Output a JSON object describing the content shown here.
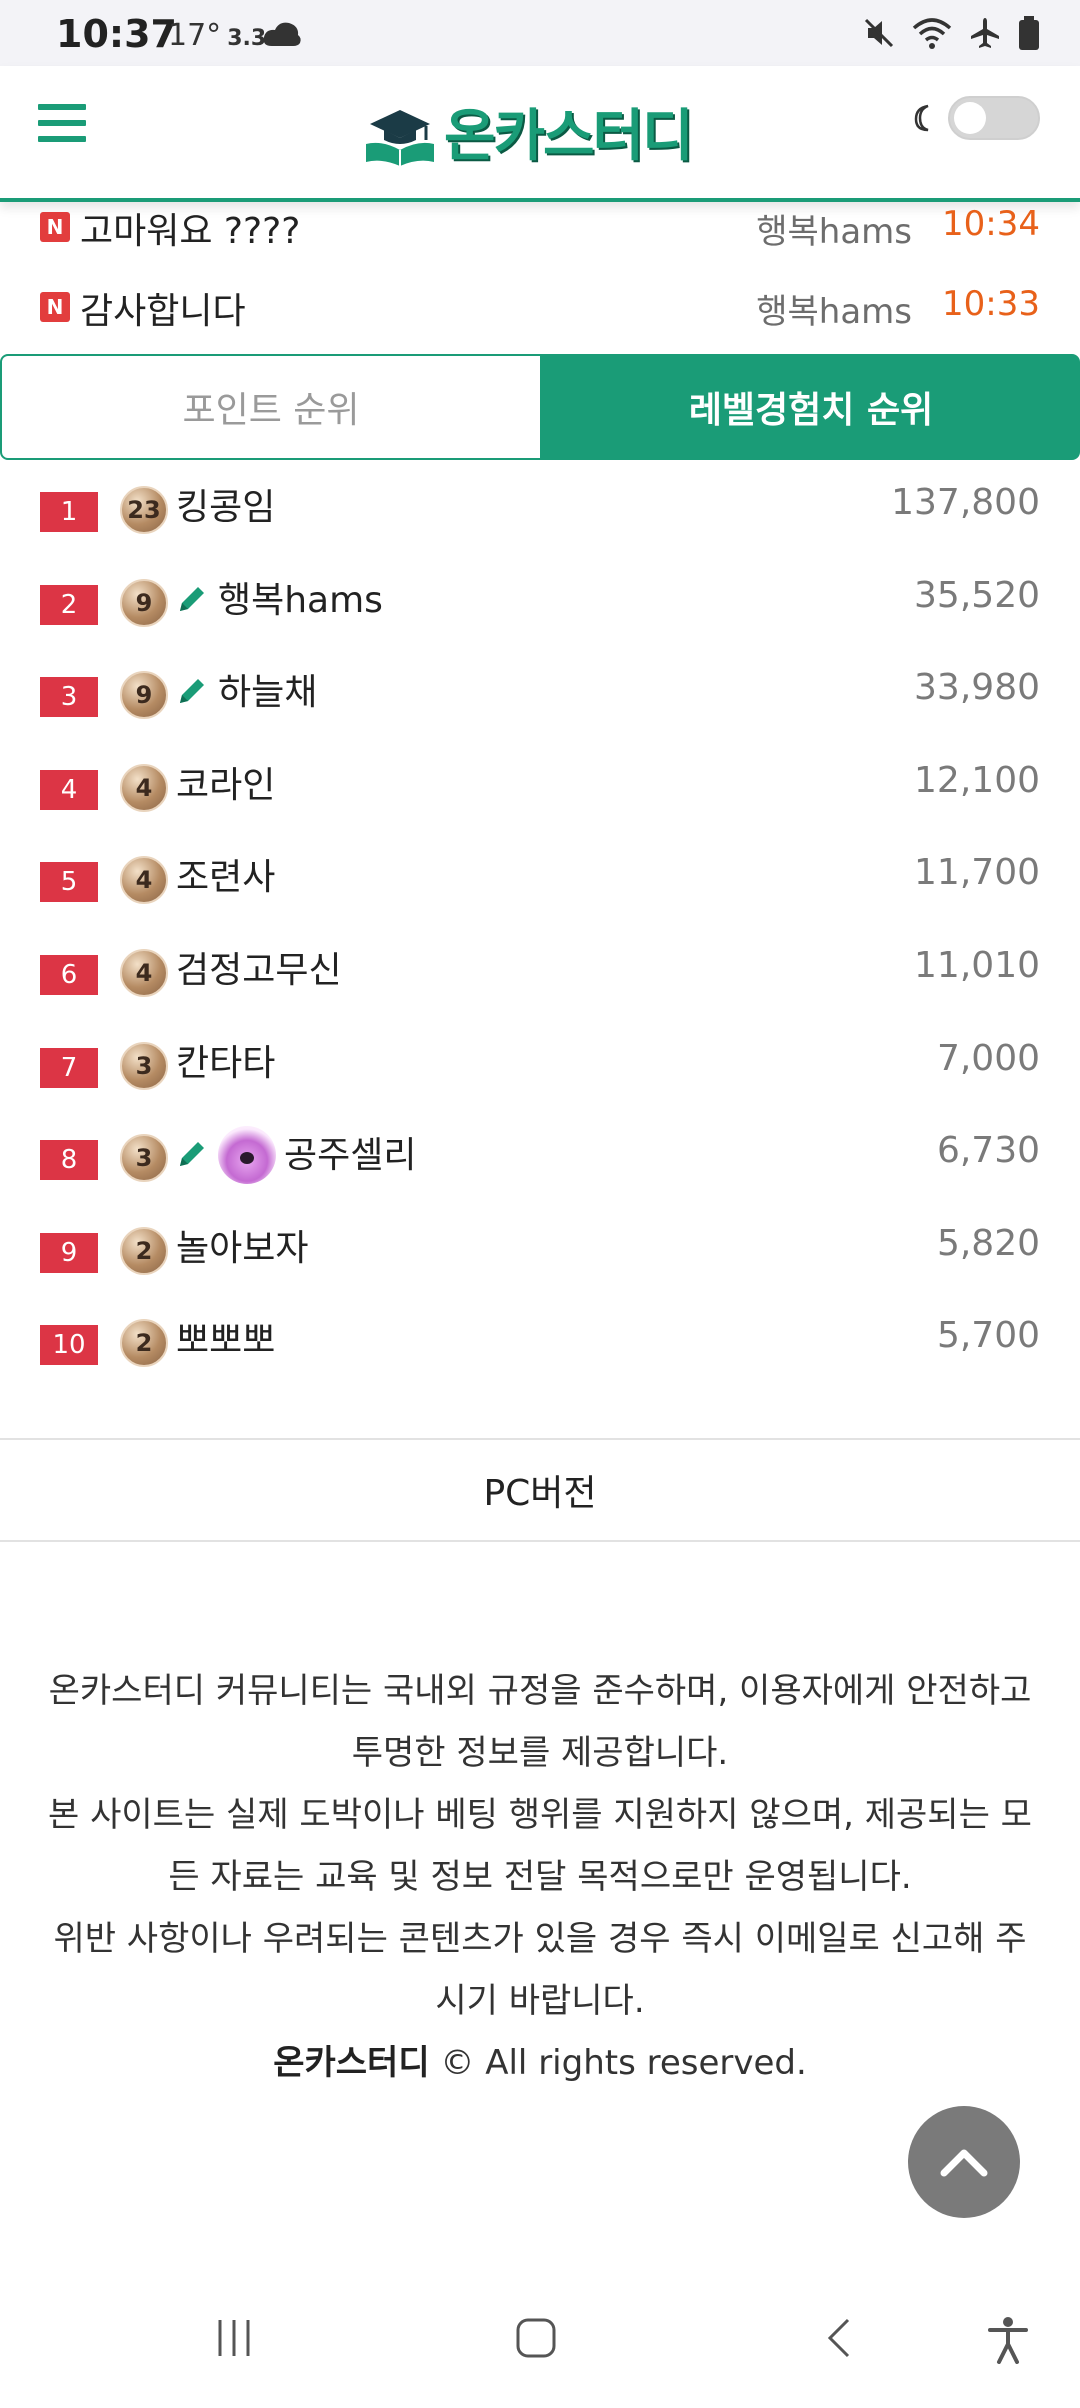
{
  "status_bar": {
    "time": "10:37",
    "temperature": "17°",
    "speed": "3.3",
    "icons": [
      "mute-icon",
      "wifi-icon",
      "airplane-icon",
      "battery-icon"
    ]
  },
  "header": {
    "logo_text": "온카스터디",
    "menu_icon": "hamburger-icon",
    "dark_mode_icon": "moon-icon"
  },
  "recent_comments": [
    {
      "badge": "N",
      "title": "고마워요 ????",
      "author": "행복hams",
      "time": "10:34"
    },
    {
      "badge": "N",
      "title": "감사합니다",
      "author": "행복hams",
      "time": "10:33"
    }
  ],
  "tabs": [
    {
      "label": "포인트 순위",
      "active": false
    },
    {
      "label": "레벨경험치 순위",
      "active": true
    }
  ],
  "ranking": [
    {
      "rank": "1",
      "level": "23",
      "name": "킹콩임",
      "score": "137,800",
      "pencil": false,
      "avatar": false
    },
    {
      "rank": "2",
      "level": "9",
      "name": "행복hams",
      "score": "35,520",
      "pencil": true,
      "avatar": false
    },
    {
      "rank": "3",
      "level": "9",
      "name": "하늘채",
      "score": "33,980",
      "pencil": true,
      "avatar": false
    },
    {
      "rank": "4",
      "level": "4",
      "name": "코라인",
      "score": "12,100",
      "pencil": false,
      "avatar": false
    },
    {
      "rank": "5",
      "level": "4",
      "name": "조련사",
      "score": "11,700",
      "pencil": false,
      "avatar": false
    },
    {
      "rank": "6",
      "level": "4",
      "name": "검정고무신",
      "score": "11,010",
      "pencil": false,
      "avatar": false
    },
    {
      "rank": "7",
      "level": "3",
      "name": "칸타타",
      "score": "7,000",
      "pencil": false,
      "avatar": false
    },
    {
      "rank": "8",
      "level": "3",
      "name": "공주셀리",
      "score": "6,730",
      "pencil": true,
      "avatar": true
    },
    {
      "rank": "9",
      "level": "2",
      "name": "놀아보자",
      "score": "5,820",
      "pencil": false,
      "avatar": false
    },
    {
      "rank": "10",
      "level": "2",
      "name": "뽀뽀뽀",
      "score": "5,700",
      "pencil": false,
      "avatar": false
    }
  ],
  "pc_version_label": "PC버전",
  "footer": {
    "line1": "온카스터디 커뮤니티는 국내외 규정을 준수하며, 이용자에게 안전하고",
    "line2": "투명한 정보를 제공합니다.",
    "line3": "본 사이트는 실제 도박이나 베팅 행위를 지원하지 않으며, 제공되는 모",
    "line4": "든 자료는 교육 및 정보 전달 목적으로만 운영됩니다.",
    "line5": "위반 사항이나 우려되는 콘텐츠가 있을 경우 즉시 이메일로 신고해 주",
    "line6": "시기 바랍니다.",
    "brand": "온카스터디",
    "copyright": "© All rights reserved."
  },
  "colors": {
    "accent": "#1a9c77",
    "rank_badge": "#dc3545",
    "time": "#e8611a"
  }
}
